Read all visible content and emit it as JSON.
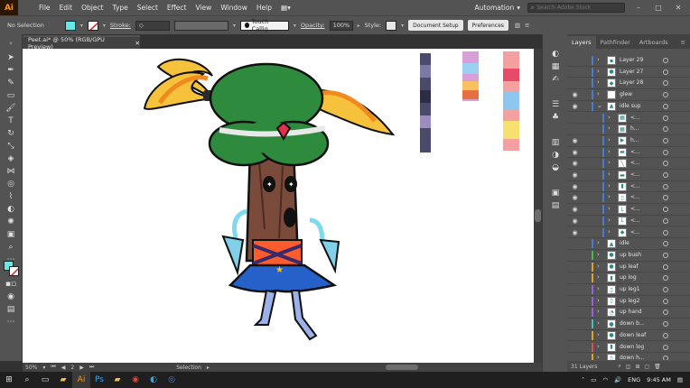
{
  "app": {
    "logo": "Ai",
    "menus": [
      "File",
      "Edit",
      "Object",
      "Type",
      "Select",
      "Effect",
      "View",
      "Window",
      "Help"
    ],
    "workspace": "Automation",
    "search_placeholder": "Search Adobe Stock"
  },
  "control_bar": {
    "selection_label": "No Selection",
    "stroke_label": "Stroke:",
    "brush_name": "Touch Callig...",
    "opacity_label": "Opacity:",
    "opacity_value": "100%",
    "style_label": "Style:",
    "document_setup": "Document Setup",
    "preferences": "Preferences",
    "fill_color": "#66e8e8"
  },
  "document": {
    "tab_title": "Peet.ai* @ 50% (RGB/GPU Preview)",
    "zoom": "50%",
    "artboard_number": "2",
    "status_text": "Selection"
  },
  "panel": {
    "tabs": [
      "Layers",
      "Pathfinder",
      "Artboards"
    ],
    "layer_count": "31 Layers",
    "layers": [
      {
        "name": "Layer 29",
        "visible": false,
        "indent": 0,
        "color": "#4a7bd6",
        "thumb": "▪"
      },
      {
        "name": "Layer 27",
        "visible": false,
        "indent": 0,
        "color": "#4a7bd6",
        "thumb": "●"
      },
      {
        "name": "Layer 28",
        "visible": false,
        "indent": 0,
        "color": "#4a7bd6",
        "thumb": "◆"
      },
      {
        "name": "glew",
        "visible": true,
        "indent": 0,
        "color": "#4a7bd6",
        "thumb": ""
      },
      {
        "name": "idle sup",
        "visible": true,
        "indent": 0,
        "color": "#4a7bd6",
        "thumb": "▲",
        "expanded": true
      },
      {
        "name": "<...",
        "visible": false,
        "indent": 1,
        "color": "#4a7bd6",
        "thumb": "▦"
      },
      {
        "name": "h...",
        "visible": false,
        "indent": 1,
        "color": "#4a7bd6",
        "thumb": "▦"
      },
      {
        "name": "h...",
        "visible": true,
        "indent": 1,
        "color": "#4a7bd6",
        "thumb": "▶"
      },
      {
        "name": "<...",
        "visible": true,
        "indent": 1,
        "color": "#4a7bd6",
        "thumb": "▬"
      },
      {
        "name": "<...",
        "visible": true,
        "indent": 1,
        "color": "#4a7bd6",
        "thumb": "╲"
      },
      {
        "name": "<...",
        "visible": true,
        "indent": 1,
        "color": "#4a7bd6",
        "thumb": "▬"
      },
      {
        "name": "<...",
        "visible": true,
        "indent": 1,
        "color": "#4a7bd6",
        "thumb": "▮"
      },
      {
        "name": "<...",
        "visible": true,
        "indent": 1,
        "color": "#4a7bd6",
        "thumb": "▯"
      },
      {
        "name": "<...",
        "visible": true,
        "indent": 1,
        "color": "#4a7bd6",
        "thumb": "L"
      },
      {
        "name": "<...",
        "visible": true,
        "indent": 1,
        "color": "#4a7bd6",
        "thumb": "L"
      },
      {
        "name": "<...",
        "visible": true,
        "indent": 1,
        "color": "#4a7bd6",
        "thumb": "◆"
      },
      {
        "name": "idle",
        "visible": false,
        "indent": 0,
        "color": "#4a7bd6",
        "thumb": "▲"
      },
      {
        "name": "up bush",
        "visible": false,
        "indent": 0,
        "color": "#3fbf3f",
        "thumb": "●"
      },
      {
        "name": "up leaf",
        "visible": false,
        "indent": 0,
        "color": "#e0a020",
        "thumb": "●"
      },
      {
        "name": "up log",
        "visible": false,
        "indent": 0,
        "color": "#e0a020",
        "thumb": "▮"
      },
      {
        "name": "up leg1",
        "visible": false,
        "indent": 0,
        "color": "#9a5fe0",
        "thumb": "▯"
      },
      {
        "name": "up leg2",
        "visible": false,
        "indent": 0,
        "color": "#9a5fe0",
        "thumb": "▯"
      },
      {
        "name": "up hand",
        "visible": false,
        "indent": 0,
        "color": "#9a5fe0",
        "thumb": "◔"
      },
      {
        "name": "down b...",
        "visible": false,
        "indent": 0,
        "color": "#3fbfbf",
        "thumb": "●"
      },
      {
        "name": "down leaf",
        "visible": false,
        "indent": 0,
        "color": "#e0a020",
        "thumb": "●"
      },
      {
        "name": "down log",
        "visible": false,
        "indent": 0,
        "color": "#e05050",
        "thumb": "▮"
      },
      {
        "name": "down h...",
        "visible": false,
        "indent": 0,
        "color": "#e0a020",
        "thumb": "▯"
      }
    ]
  },
  "taskbar": {
    "language": "ENG",
    "time": "9:45 AM"
  },
  "colors": {
    "chrome": "#535353",
    "dark_chrome": "#424242",
    "artboard": "#ffffff",
    "accent_cyan": "#66e8e8"
  }
}
